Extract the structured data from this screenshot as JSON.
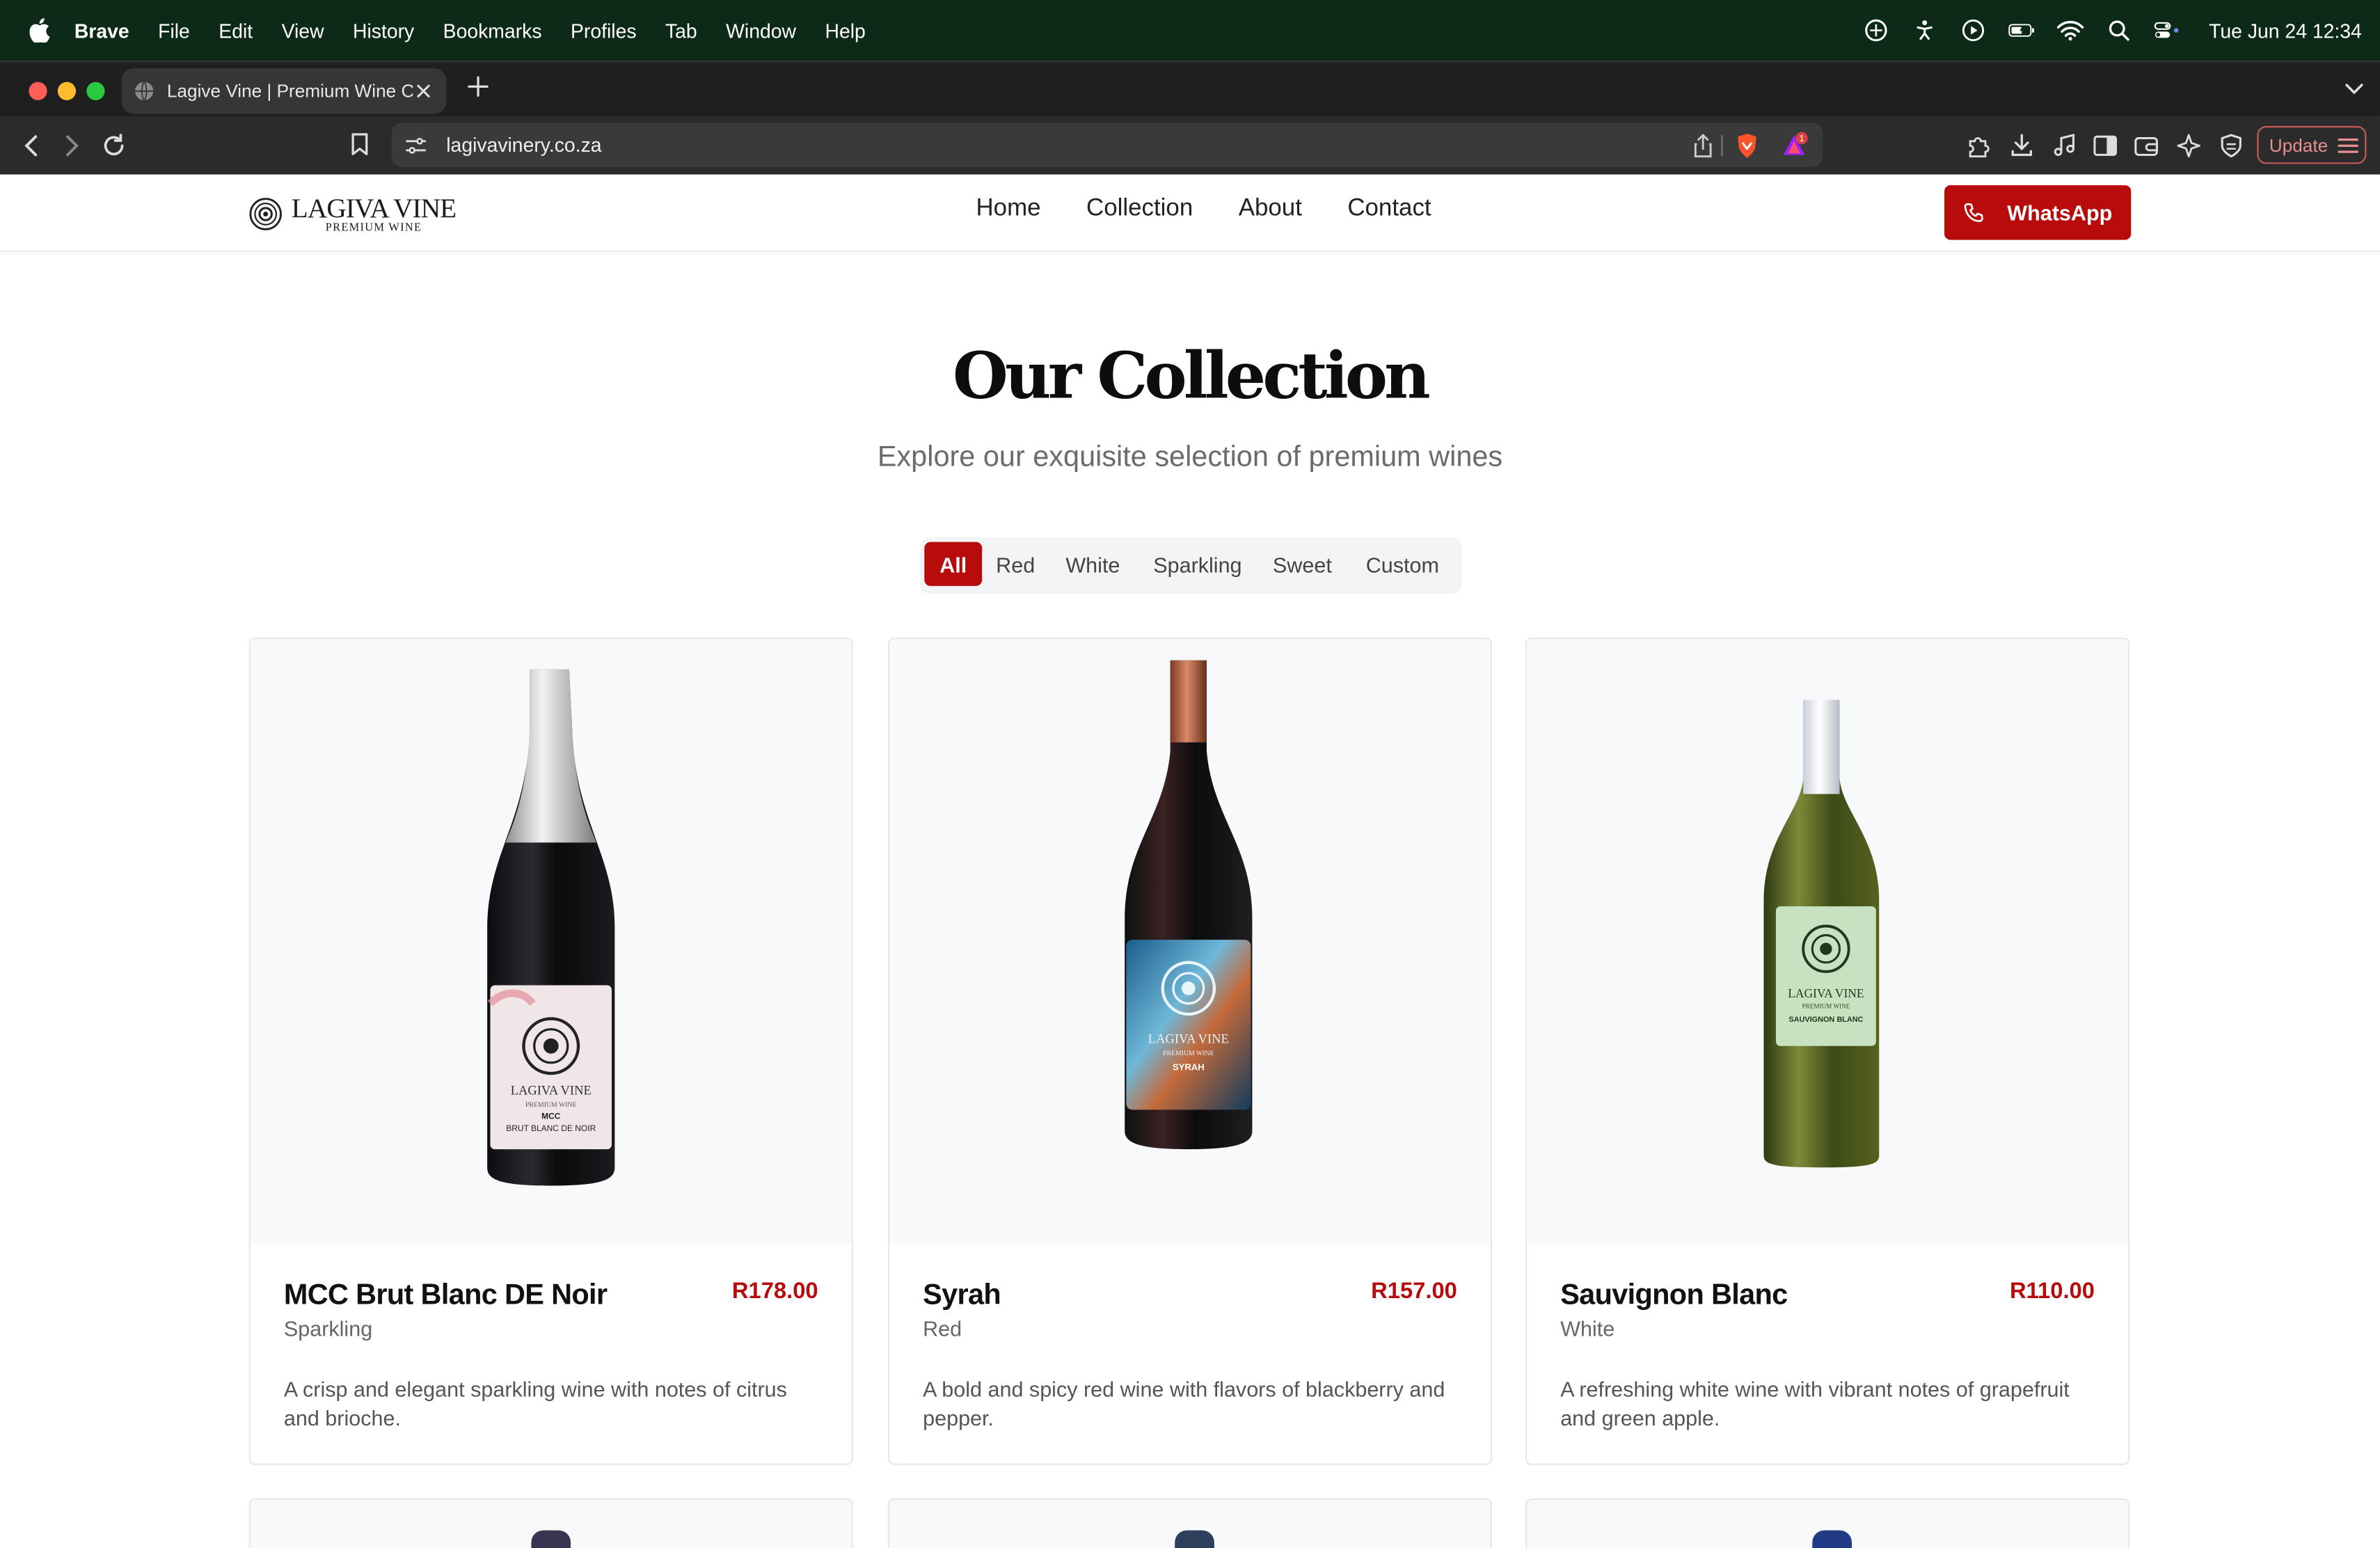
{
  "menubar": {
    "app": "Brave",
    "items": [
      "File",
      "Edit",
      "View",
      "History",
      "Bookmarks",
      "Profiles",
      "Tab",
      "Window",
      "Help"
    ],
    "clock": "Tue Jun 24  12:34"
  },
  "browser": {
    "tab_title": "Lagive Vine | Premium Wine C",
    "url": "lagivavinery.co.za",
    "update_label": "Update",
    "rewards_badge": "1"
  },
  "site": {
    "logo_line1": "LAGIVA VINE",
    "logo_line2": "PREMIUM WINE",
    "nav": [
      "Home",
      "Collection",
      "About",
      "Contact"
    ],
    "whatsapp_label": "WhatsApp"
  },
  "collection": {
    "title": "Our Collection",
    "subtitle": "Explore our exquisite selection of premium wines",
    "filters": [
      "All",
      "Red",
      "White",
      "Sparkling",
      "Sweet",
      "Custom"
    ],
    "active_filter": "All",
    "products": [
      {
        "name": "MCC Brut Blanc DE Noir",
        "price": "R178.00",
        "category": "Sparkling",
        "description": "A crisp and elegant sparkling wine with notes of citrus and brioche.",
        "label_lines": [
          "LAGIVA VINE",
          "PREMIUM WINE",
          "MCC",
          "BRUT BLANC DE NOIR"
        ]
      },
      {
        "name": "Syrah",
        "price": "R157.00",
        "category": "Red",
        "description": "A bold and spicy red wine with flavors of blackberry and pepper.",
        "label_lines": [
          "LAGIVA VINE",
          "PREMIUM WINE",
          "SYRAH"
        ]
      },
      {
        "name": "Sauvignon Blanc",
        "price": "R110.00",
        "category": "White",
        "description": "A refreshing white wine with vibrant notes of grapefruit and green apple.",
        "label_lines": [
          "LAGIVA VINE",
          "PREMIUM WINE",
          "SAUVIGNON BLANC"
        ]
      }
    ]
  },
  "colors": {
    "brand_red": "#b80c0c",
    "menubar_bg": "#0c2a17",
    "chrome_dark": "#2b2b2b"
  }
}
